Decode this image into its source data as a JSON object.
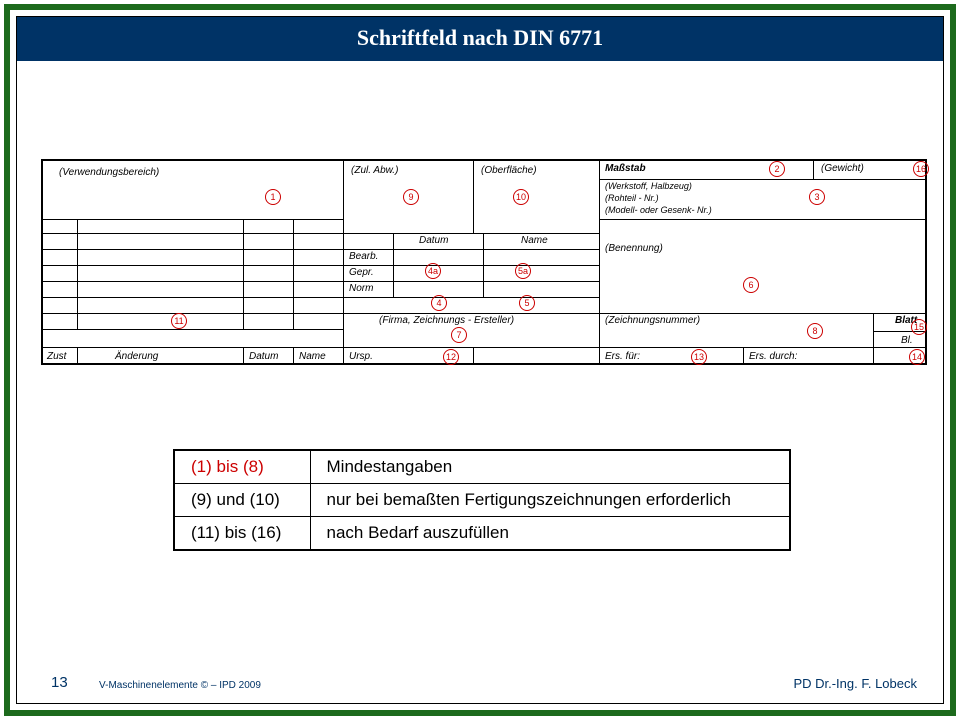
{
  "title": "Schriftfeld nach DIN 6771",
  "sf": {
    "verwendungsbereich": "(Verwendungsbereich)",
    "zul_abw": "(Zul. Abw.)",
    "oberflaeche": "(Oberfläche)",
    "massstab": "Maßstab",
    "gewicht": "(Gewicht)",
    "werkstoff1": "(Werkstoff, Halbzeug)",
    "werkstoff2": "(Rohteil - Nr.)",
    "werkstoff3": "(Modell- oder Gesenk- Nr.)",
    "datum": "Datum",
    "name": "Name",
    "bearb": "Bearb.",
    "gepr": "Gepr.",
    "norm": "Norm",
    "benennung": "(Benennung)",
    "firma": "(Firma, Zeichnungs - Ersteller)",
    "zeichnungsnummer": "(Zeichnungsnummer)",
    "blatt": "Blatt",
    "bl": "Bl.",
    "zust": "Zust",
    "aenderung": "Änderung",
    "datum2": "Datum",
    "name2": "Name",
    "ursp": "Ursp.",
    "ers_fuer": "Ers. für:",
    "ers_durch": "Ers. durch:"
  },
  "markers": {
    "m1": "1",
    "m2": "2",
    "m3": "3",
    "m4": "4",
    "m4a": "4a",
    "m5": "5",
    "m5a": "5a",
    "m6": "6",
    "m7": "7",
    "m8": "8",
    "m9": "9",
    "m10": "10",
    "m11": "11",
    "m12": "12",
    "m13": "13",
    "m14": "14",
    "m15": "15",
    "m16": "16"
  },
  "legend": [
    {
      "key": "(1) bis (8)",
      "key_style": "red",
      "val": "Mindestangaben"
    },
    {
      "key": "(9) und (10)",
      "key_style": "",
      "val": "nur bei bemaßten Fertigungszeichnungen erforderlich"
    },
    {
      "key": "(11) bis (16)",
      "key_style": "",
      "val": "nach Bedarf auszufüllen"
    }
  ],
  "footer": {
    "page": "13",
    "copyright": "V-Maschinenelemente © – IPD 2009",
    "author": "PD Dr.-Ing. F. Lobeck"
  }
}
